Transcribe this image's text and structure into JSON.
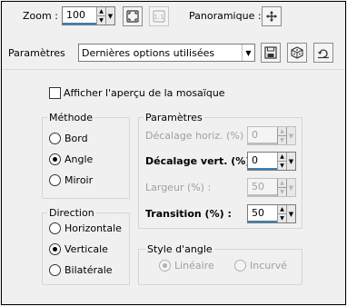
{
  "toolbar": {
    "zoom_label": "Zoom :",
    "zoom_value": "100",
    "pan_label": "Panoramique :"
  },
  "presets": {
    "label": "Paramètres",
    "selected": "Dernières options utilisées"
  },
  "preview_checkbox": {
    "label": "Afficher l'aperçu de la mosaïque",
    "checked": false
  },
  "method_group": {
    "title": "Méthode",
    "options": [
      "Bord",
      "Angle",
      "Miroir"
    ],
    "selected": "Angle"
  },
  "params_group": {
    "title": "Paramètres",
    "h_offset_label": "Décalage horiz. (%) :",
    "h_offset_value": "0",
    "v_offset_label": "Décalage vert. (%) :",
    "v_offset_value": "0",
    "width_label": "Largeur (%) :",
    "width_value": "50",
    "transition_label": "Transition (%) :",
    "transition_value": "50"
  },
  "direction_group": {
    "title": "Direction",
    "options": [
      "Horizontale",
      "Verticale",
      "Bilatérale"
    ],
    "selected": "Verticale"
  },
  "corner_style_group": {
    "title": "Style d'angle",
    "options": [
      "Linéaire",
      "Incurvé"
    ],
    "selected": "Linéaire"
  }
}
